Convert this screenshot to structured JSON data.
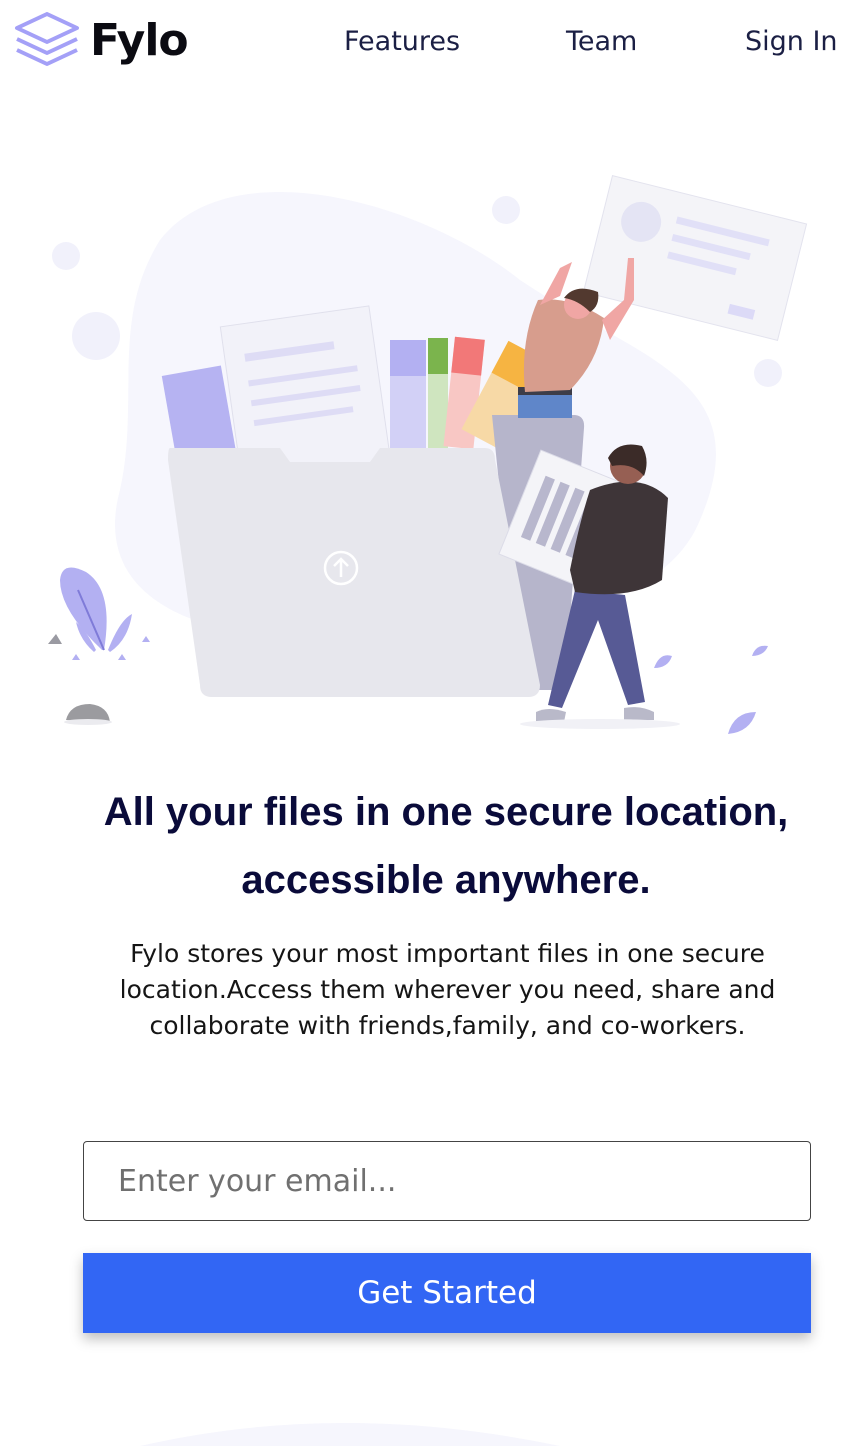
{
  "brand": {
    "name": "Fylo",
    "logo_icon": "stacked-layers-icon",
    "accent_color": "#a4a0f7"
  },
  "nav": {
    "items": [
      {
        "label": "Features"
      },
      {
        "label": "Team"
      },
      {
        "label": "Sign In"
      }
    ]
  },
  "hero": {
    "illustration": "people-organizing-files-illustration",
    "headline_line1": "All your files in one secure location,",
    "headline_line2": "accessible anywhere.",
    "description": "Fylo stores your most important files in one secure location.Access them wherever you need, share and collaborate with friends,family, and co-workers."
  },
  "signup": {
    "email_placeholder": "Enter your email...",
    "email_value": "",
    "button_label": "Get Started",
    "button_color": "#3266f4"
  },
  "colors": {
    "heading": "#0a0b3a",
    "text": "#151515",
    "nav_text": "#1b1f44"
  }
}
